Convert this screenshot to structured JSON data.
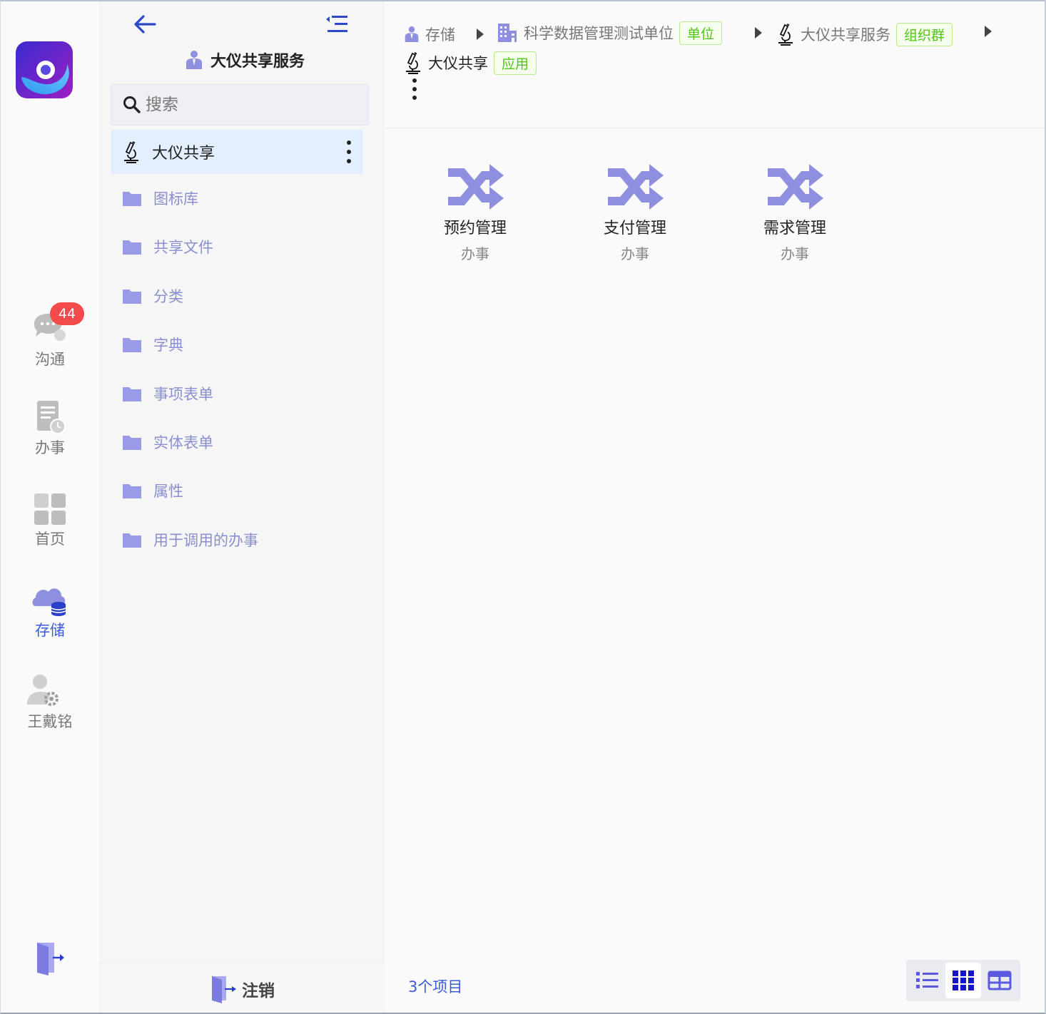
{
  "rail": {
    "items": [
      {
        "label": "沟通",
        "badge": "44"
      },
      {
        "label": "办事"
      },
      {
        "label": "首页"
      },
      {
        "label": "存储"
      },
      {
        "label": "王戴铭"
      }
    ],
    "active": "存储"
  },
  "panel": {
    "title": "大仪共享服务",
    "search_placeholder": "搜索",
    "root_item": "大仪共享",
    "folders": [
      "图标库",
      "共享文件",
      "分类",
      "字典",
      "事项表单",
      "实体表单",
      "属性",
      "用于调用的办事"
    ],
    "logout_label": "注销"
  },
  "breadcrumb": {
    "items": [
      {
        "label": "存储",
        "tag": ""
      },
      {
        "label": "科学数据管理测试单位",
        "tag": "单位"
      },
      {
        "label": "大仪共享服务",
        "tag": "组织群"
      },
      {
        "label": "大仪共享",
        "tag": "应用"
      }
    ]
  },
  "main": {
    "items": [
      {
        "name": "预约管理",
        "type": "办事",
        "icon": "shuffle-icon"
      },
      {
        "name": "支付管理",
        "type": "办事",
        "icon": "shuffle-icon"
      },
      {
        "name": "需求管理",
        "type": "办事",
        "icon": "shuffle-icon"
      }
    ],
    "count_label": "3个项目",
    "view_mode": "grid"
  },
  "colors": {
    "accent": "#3b5bdb",
    "icon_purple": "#8f8fe0",
    "badge_red": "#f34b4b",
    "tag_green": "#52c41a",
    "selected_bg": "#e3efff"
  }
}
